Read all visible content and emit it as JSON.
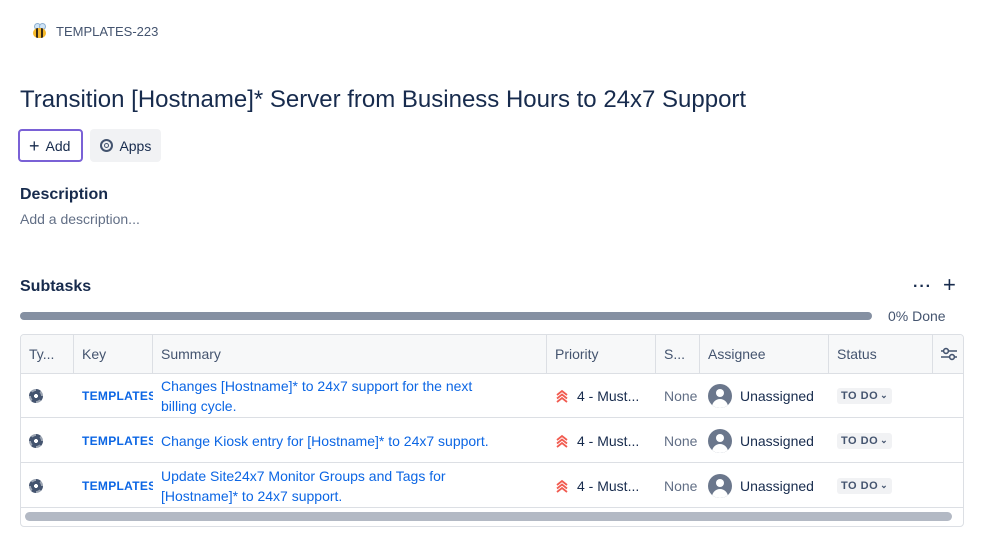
{
  "breadcrumb": {
    "issue_key": "TEMPLATES-223"
  },
  "page": {
    "title": "Transition [Hostname]* Server from Business Hours to 24x7 Support"
  },
  "actions": {
    "add_label": "Add",
    "apps_label": "Apps"
  },
  "description": {
    "label": "Description",
    "placeholder": "Add a description..."
  },
  "subtasks": {
    "label": "Subtasks",
    "more_label": "···",
    "add_label": "+",
    "progress_percent": 0,
    "progress_text": "0% Done",
    "columns": [
      "Ty...",
      "Key",
      "Summary",
      "Priority",
      "S...",
      "Assignee",
      "Status"
    ],
    "rows": [
      {
        "key": "TEMPLATES",
        "summary": "Changes [Hostname]* to 24x7 support for the next billing cycle.",
        "priority": "4 - Must...",
        "story_points": "None",
        "assignee": "Unassigned",
        "status": "TO DO"
      },
      {
        "key": "TEMPLATES",
        "summary": "Change Kiosk entry for [Hostname]* to 24x7 support.",
        "priority": "4 - Must...",
        "story_points": "None",
        "assignee": "Unassigned",
        "status": "TO DO"
      },
      {
        "key": "TEMPLATES",
        "summary": "Update Site24x7 Monitor Groups and Tags for [Hostname]* to 24x7 support.",
        "priority": "4 - Must...",
        "story_points": "None",
        "assignee": "Unassigned",
        "status": "TO DO"
      }
    ]
  },
  "colors": {
    "link": "#0c66e4",
    "priority": "#f15b50",
    "focus": "#7a61d6"
  },
  "icons": {
    "project": "bee-icon",
    "type": "subtask-icon",
    "priority": "priority-arrows-icon",
    "config": "column-config-icon"
  }
}
